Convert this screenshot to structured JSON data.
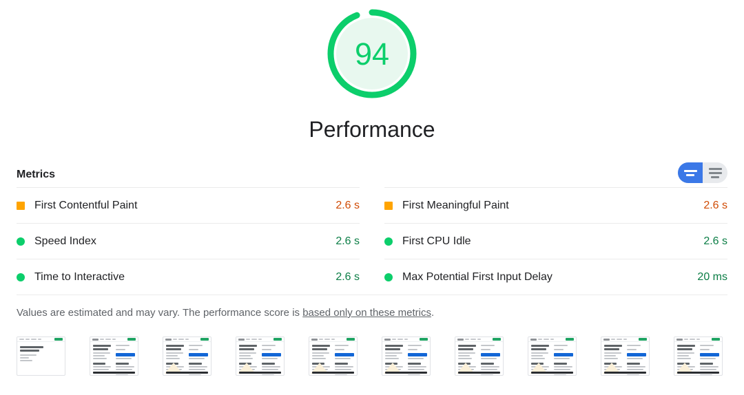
{
  "gauge": {
    "score": "94",
    "score_value": 94,
    "category_title": "Performance",
    "arc_color": "#0cce6b",
    "fill_color": "#e8f8ef",
    "score_color": "#0cce6b"
  },
  "metrics_section": {
    "heading": "Metrics",
    "toggle": {
      "filmstrip_view_label": "Toggle filmstrip view",
      "list_view_label": "Toggle list view",
      "active": "filmstrip",
      "active_color": "#3b78e7",
      "inactive_color": "#e8eaed"
    },
    "columns": [
      {
        "rows": [
          {
            "icon": "square",
            "icon_color": "#ffa400",
            "label": "First Contentful Paint",
            "value": "2.6 s",
            "rating": "average",
            "value_color": "#d04b04"
          },
          {
            "icon": "circle",
            "icon_color": "#0cce6b",
            "label": "Speed Index",
            "value": "2.6 s",
            "rating": "good",
            "value_color": "#0a7d45"
          },
          {
            "icon": "circle",
            "icon_color": "#0cce6b",
            "label": "Time to Interactive",
            "value": "2.6 s",
            "rating": "good",
            "value_color": "#0a7d45"
          }
        ]
      },
      {
        "rows": [
          {
            "icon": "square",
            "icon_color": "#ffa400",
            "label": "First Meaningful Paint",
            "value": "2.6 s",
            "rating": "average",
            "value_color": "#d04b04"
          },
          {
            "icon": "circle",
            "icon_color": "#0cce6b",
            "label": "First CPU Idle",
            "value": "2.6 s",
            "rating": "good",
            "value_color": "#0a7d45"
          },
          {
            "icon": "circle",
            "icon_color": "#0cce6b",
            "label": "Max Potential First Input Delay",
            "value": "20 ms",
            "rating": "good",
            "value_color": "#0a7d45"
          }
        ]
      }
    ]
  },
  "disclaimer": {
    "text_before": "Values are estimated and may vary. The performance score is ",
    "link_text": "based only on these metrics",
    "text_after": "."
  },
  "filmstrip": {
    "count": 10,
    "frames": [
      {
        "state": "blank"
      },
      {
        "state": "loaded"
      },
      {
        "state": "loaded"
      },
      {
        "state": "loaded"
      },
      {
        "state": "loaded"
      },
      {
        "state": "loaded"
      },
      {
        "state": "loaded"
      },
      {
        "state": "loaded"
      },
      {
        "state": "loaded"
      },
      {
        "state": "loaded"
      }
    ]
  }
}
